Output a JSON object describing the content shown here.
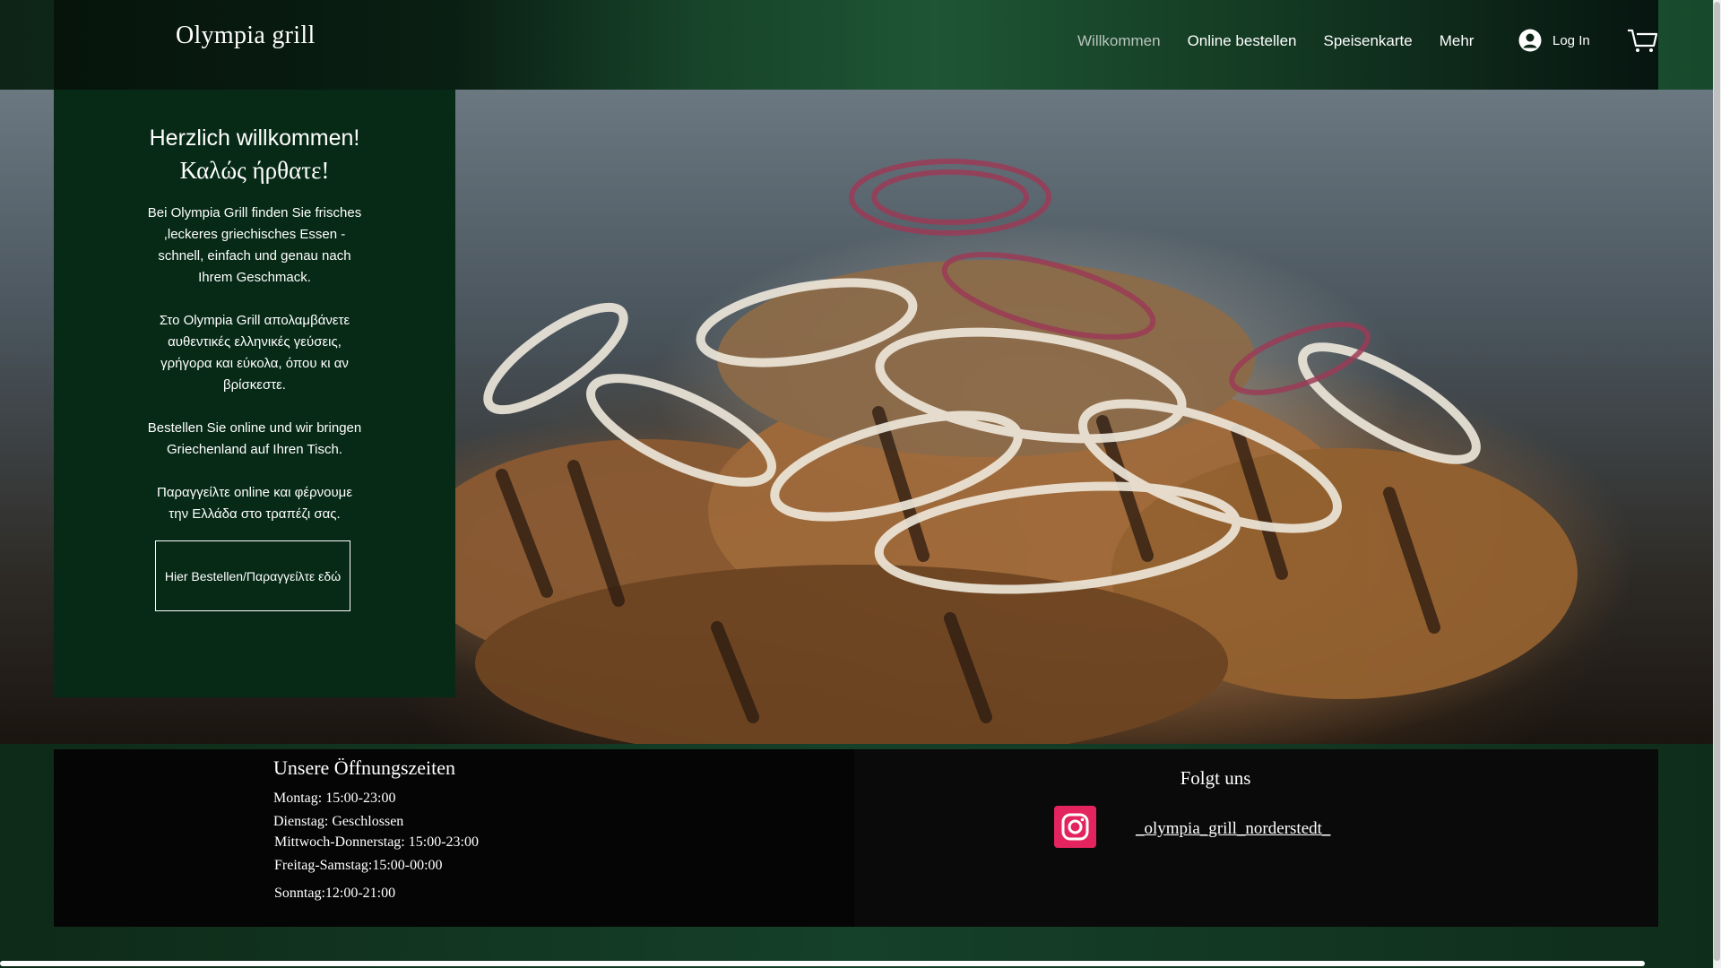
{
  "site": {
    "logo": "Olympia grill"
  },
  "nav": {
    "items": [
      {
        "label": "Willkommen",
        "active": true
      },
      {
        "label": "Online bestellen",
        "active": false
      },
      {
        "label": "Speisenkarte",
        "active": false
      },
      {
        "label": "Mehr",
        "active": false
      }
    ],
    "login_label": "Log In"
  },
  "welcome": {
    "title": "Herzlich willkommen!",
    "title_greek": "Καλώς ήρθατε!",
    "paragraph_1": "Bei Olympia Grill finden Sie frisches ,leckeres griechisches Essen - schnell, einfach und genau nach Ihrem Geschmack.",
    "paragraph_2": "Στο Olympia Grill απολαμβάνετε αυθεντικές ελληνικές γεύσεις, γρήγορα και εύκολα, όπου κι αν βρίσκεστε.",
    "paragraph_3": "Bestellen Sie online und wir bringen Griechenland auf Ihren Tisch.",
    "paragraph_4": "Παραγγείλτε online και φέρνουμε την Ελλάδα στο τραπέζι σας.",
    "order_button": "Hier Bestellen/Παραγγείλτε εδώ"
  },
  "hours": {
    "title": "Unsere Öffnungszeiten",
    "lines": [
      "Montag: 15:00-23:00",
      "Dienstag: Geschlossen",
      "Mittwoch-Donnerstag: 15:00-23:00",
      "Freitag-Samstag:15:00-00:00",
      "Sonntag:12:00-21:00"
    ]
  },
  "social": {
    "title": "Folgt uns",
    "instagram_handle": "_olympia_grill_norderstedt_"
  },
  "colors": {
    "panel_green": "#072a17",
    "instagram_pink": "#e4245f",
    "nav_active": "#b9c4bd"
  },
  "icons": {
    "login": "user-avatar-icon",
    "cart": "shopping-cart-icon",
    "social": "instagram-icon"
  }
}
